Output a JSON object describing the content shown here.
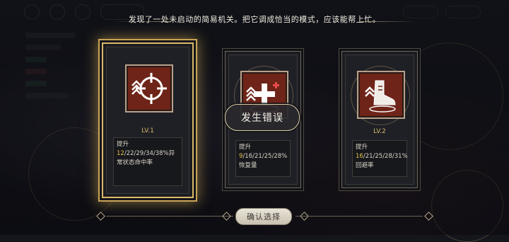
{
  "message": "发现了一处未启动的简易机关。把它调成恰当的模式，应该能帮上忙。",
  "cards": [
    {
      "icon": "crosshair-chevron-icon",
      "title": "",
      "level": "LV.1",
      "desc_prefix": "提升",
      "desc_highlight": "12",
      "desc_suffix": "/22/29/34/38%异常状态命中率",
      "selected": true
    },
    {
      "icon": "plus-heal-icon",
      "title": "",
      "level": "",
      "desc_prefix": "提升",
      "desc_highlight": "9",
      "desc_suffix": "/16/21/25/28%恢复量",
      "selected": false
    },
    {
      "icon": "winged-boot-icon",
      "title": "",
      "level": "LV.2",
      "desc_prefix": "提升",
      "desc_highlight": "16",
      "desc_suffix": "/21/25/28/31%回避率",
      "selected": false
    }
  ],
  "error_toast": "发生错误",
  "confirm_label": "确认选择",
  "colors": {
    "gold": "#d9b86a",
    "icon_bg": "#6e2418",
    "highlight": "#e8c24a"
  }
}
